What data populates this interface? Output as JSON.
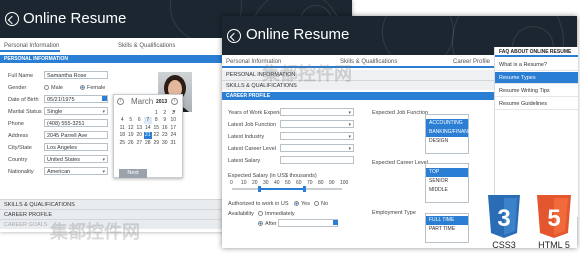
{
  "back_window": {
    "title": "Online Resume",
    "tabs": [
      "Personal Information",
      "Skills & Qualifications"
    ],
    "section_header": "PERSONAL INFORMATION",
    "form": [
      {
        "label": "Full Name",
        "value": "Samantha Rose"
      },
      {
        "label": "Gender",
        "male": "Male",
        "female": "Female"
      },
      {
        "label": "Date of Birth",
        "value": "05/21/1975"
      },
      {
        "label": "Marital Status",
        "value": "Single"
      },
      {
        "label": "Phone",
        "value": "(408) 555-3251"
      },
      {
        "label": "Address",
        "value": "2045 Parrell Ave"
      },
      {
        "label": "City/State",
        "value": "Los Angeles"
      },
      {
        "label": "Country",
        "value": "United States"
      },
      {
        "label": "Nationality",
        "value": "American"
      }
    ],
    "calendar": {
      "month": "March",
      "year": "2013",
      "days": [
        [
          "",
          "",
          "",
          "",
          "1",
          "2",
          "3"
        ],
        [
          "4",
          "5",
          "6",
          "7",
          "8",
          "9",
          "10"
        ],
        [
          "11",
          "12",
          "13",
          "14",
          "15",
          "16",
          "17"
        ],
        [
          "18",
          "19",
          "20",
          "21",
          "22",
          "23",
          "24"
        ],
        [
          "25",
          "26",
          "27",
          "28",
          "29",
          "30",
          "31"
        ]
      ],
      "next_label": "Next"
    },
    "bottom_sections": [
      "SKILLS & QUALIFICATIONS",
      "CAREER PROFILE",
      "CAREER GOALS"
    ]
  },
  "front_window": {
    "title": "Online Resume",
    "tabs": [
      "Personal Information",
      "Skills & Qualifications",
      "Career Profile"
    ],
    "sections": [
      "PERSONAL INFORMATION",
      "SKILLS & QUALIFICATIONS"
    ],
    "career_header": "CAREER PROFILE",
    "left_labels": [
      "Years of Work Experience",
      "Latest Job Function",
      "Latest Industry",
      "Latest Career Level",
      "Latest Salary"
    ],
    "expected_salary_label": "Expected Salary (in US$ thousands)",
    "salary_ticks": [
      "0",
      "10",
      "20",
      "30",
      "40",
      "50",
      "60",
      "70",
      "80",
      "90",
      "100"
    ],
    "authorized_label": "Authorized to work in US",
    "yes": "Yes",
    "no": "No",
    "availability_label": "Availability",
    "immediately": "Immediately",
    "after": "After",
    "expected_job_function_label": "Expected Job Function",
    "job_functions": [
      "ACCOUNTING",
      "BANKING/FINANCE",
      "DESIGN"
    ],
    "expected_career_level_label": "Expected Career Level",
    "career_levels": [
      "TOP",
      "SENIOR",
      "MIDDLE"
    ],
    "employment_type_label": "Employment Type",
    "employment_types": [
      "FULL TIME",
      "PART TIME"
    ]
  },
  "faq": {
    "header": "FAQ ABOUT ONLINE RESUME",
    "items": [
      "What is a Resume?",
      "Resume Types",
      "Resume Writing Tips",
      "Resume Guidelines"
    ]
  },
  "badges": {
    "css": "CSS3",
    "html": "HTML 5"
  },
  "colors": {
    "accent": "#2a7ed3",
    "header": "#1b2630",
    "css_badge": "#2b6db4",
    "html_badge": "#e4572e"
  }
}
